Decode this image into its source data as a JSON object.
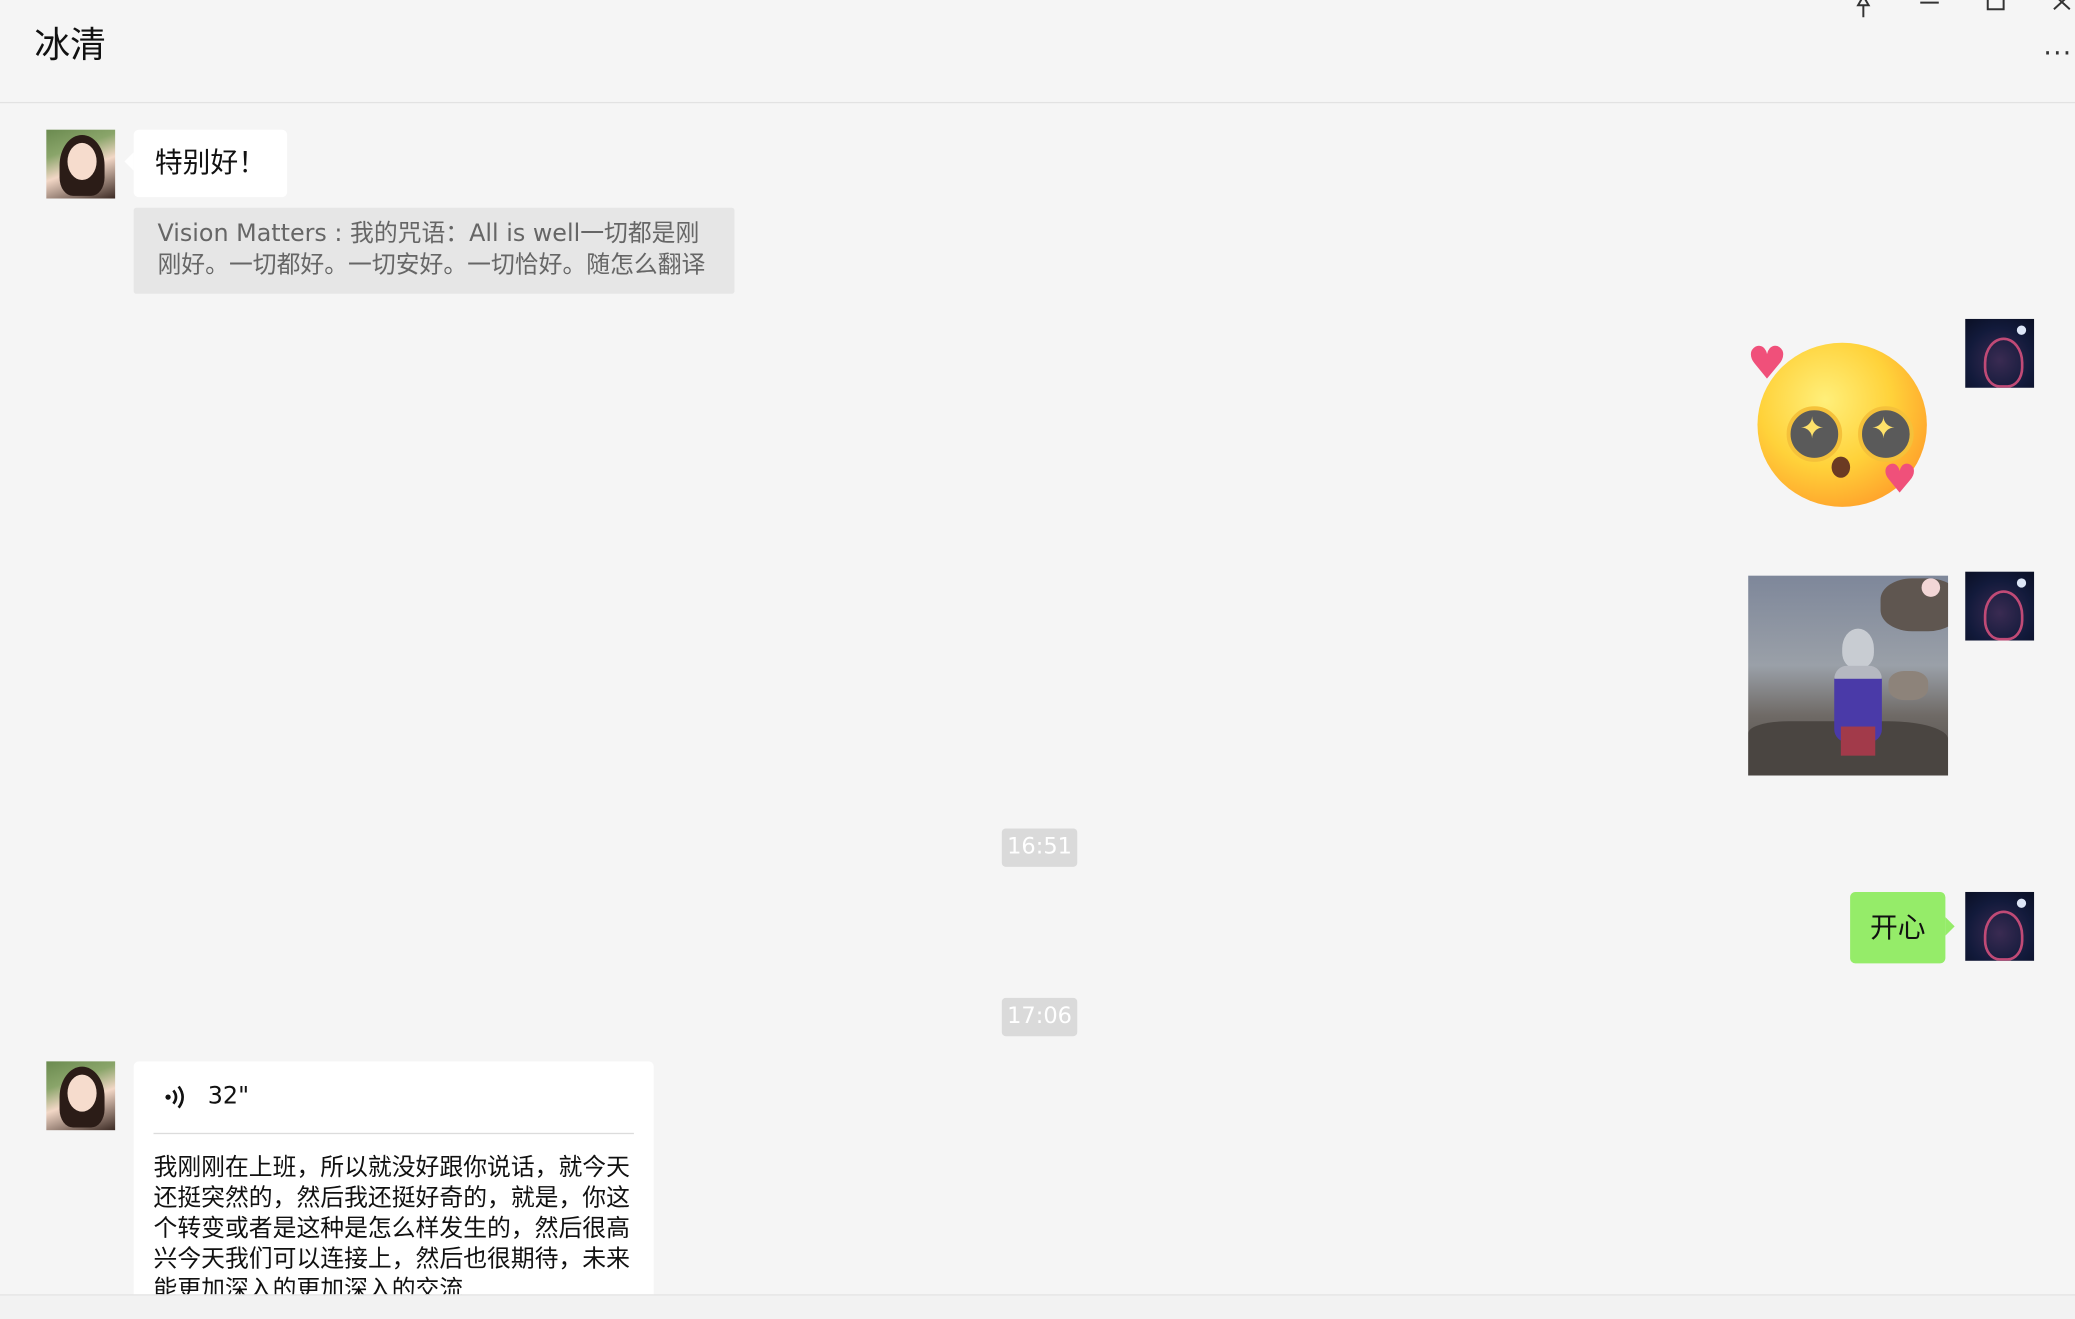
{
  "window": {
    "title": "冰清",
    "more_label": "···",
    "pin_icon": "pin-icon",
    "minimize_icon": "minimize-icon",
    "maximize_icon": "maximize-icon",
    "close_icon": "close-icon"
  },
  "messages": {
    "msg1": {
      "text": "特别好！"
    },
    "quote1": {
      "text": "Vision Matters : 我的咒语：All is well一切都是刚刚好。一切都好。一切安好。一切恰好。随怎么翻译"
    },
    "time1": "16:51",
    "msg_green": {
      "text": "开心"
    },
    "time2": "17:06",
    "voice": {
      "duration": "32\"",
      "transcript": "我刚刚在上班，所以就没好跟你说话，就今天还挺突然的，然后我还挺好奇的，就是，你这个转变或者是这种是怎么样发生的，然后很高兴今天我们可以连接上，然后也很期待，未来能更加深入的更加深入的交流"
    }
  },
  "colors": {
    "background": "#f5f5f5",
    "incoming_bubble": "#ffffff",
    "outgoing_bubble": "#95ec69",
    "quote_bg": "#e6e6e6",
    "time_chip": "#dadada"
  }
}
